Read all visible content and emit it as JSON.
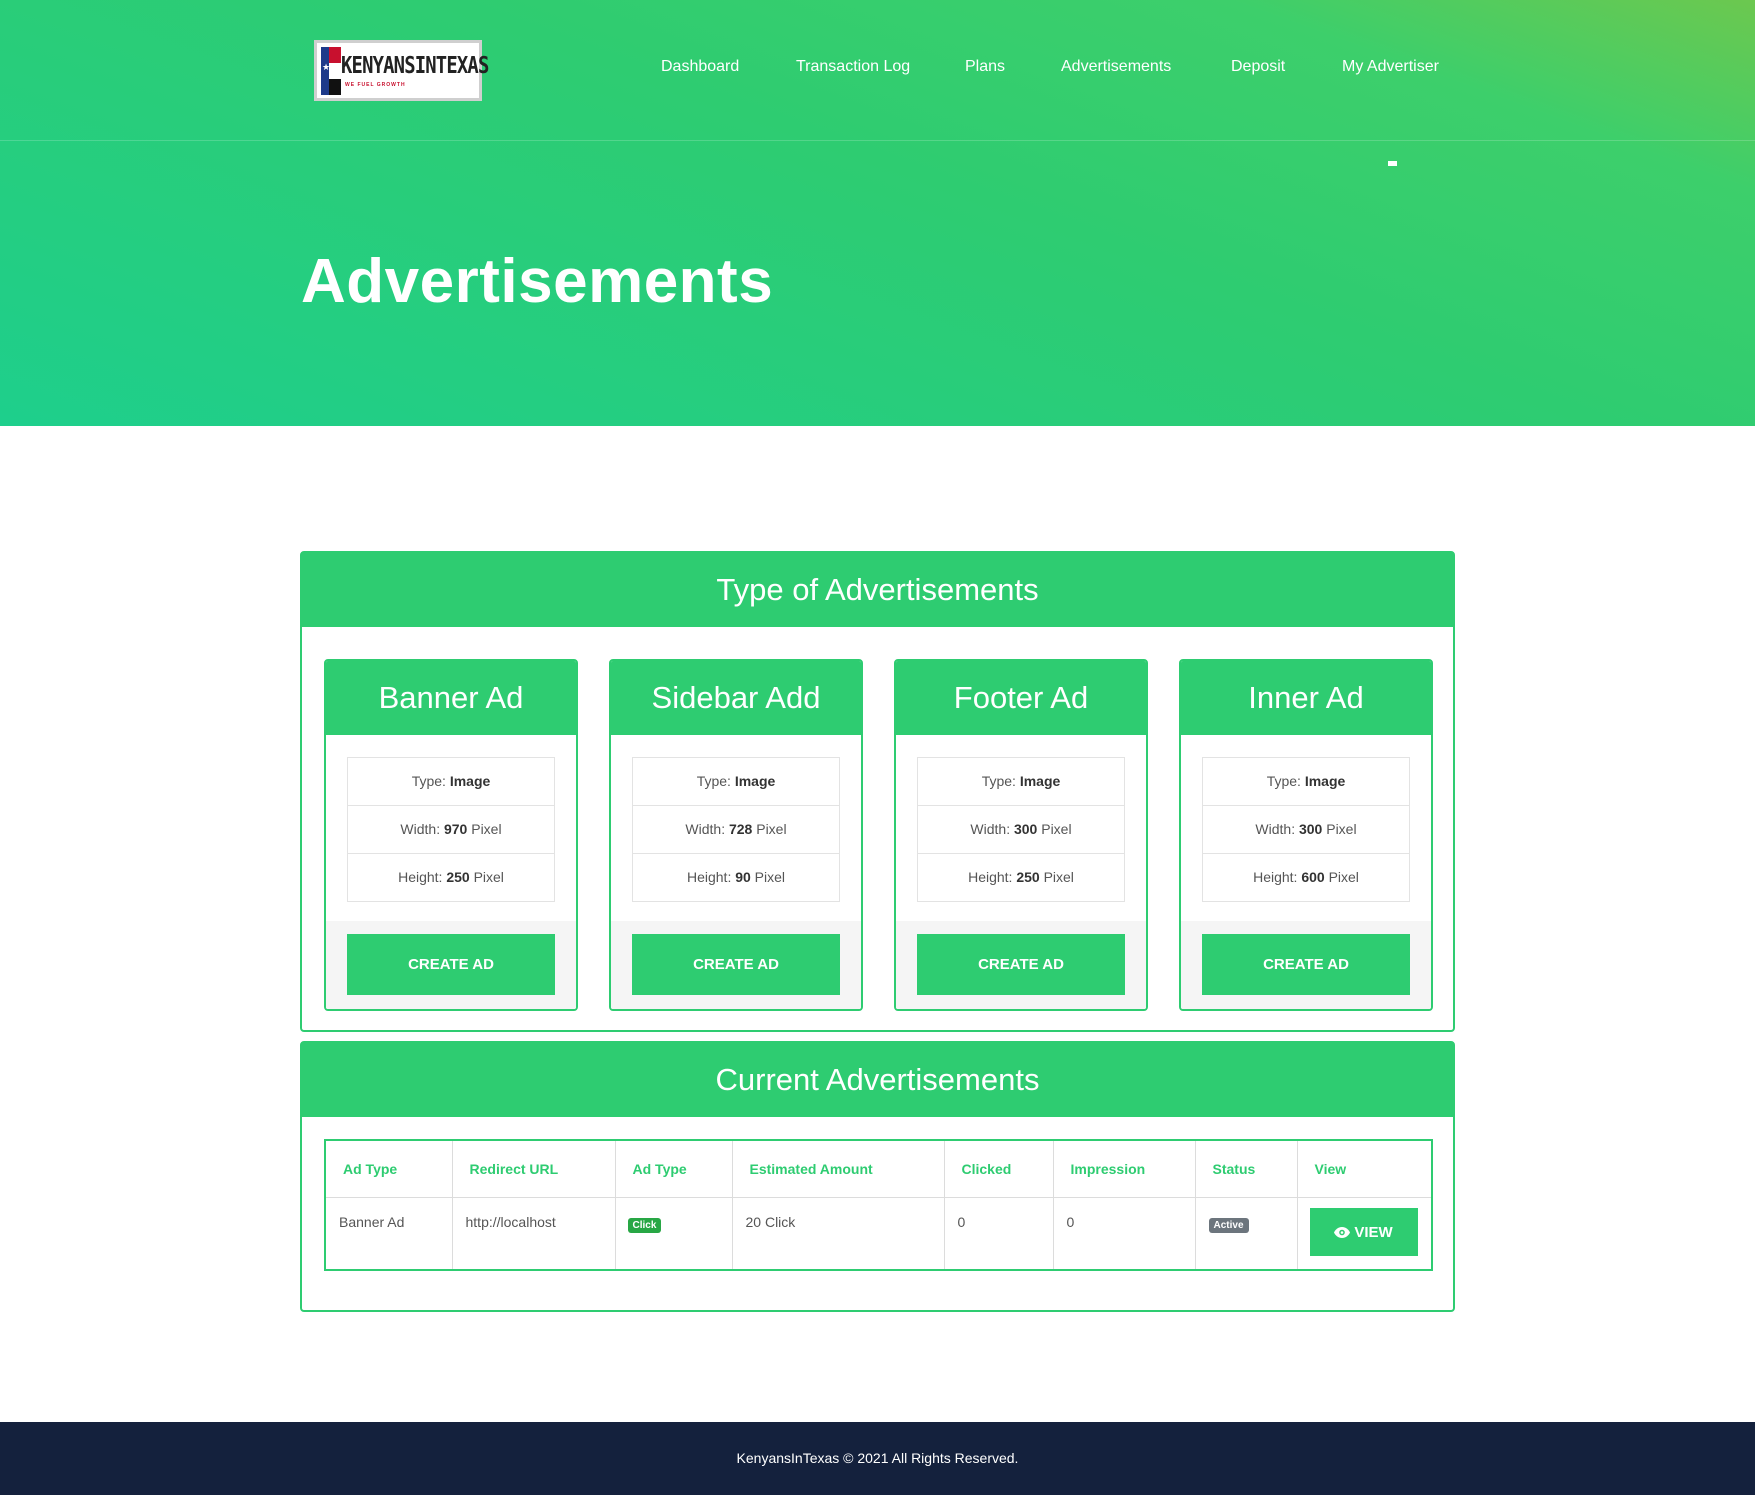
{
  "header": {
    "logo": {
      "wordmark": "KENYANSINTEXAS",
      "tagline": "WE FUEL GROWTH"
    },
    "nav": [
      {
        "label": "Dashboard"
      },
      {
        "label": "Transaction Log"
      },
      {
        "label": "Plans"
      },
      {
        "label": "Advertisements"
      },
      {
        "label": "Deposit"
      },
      {
        "label": "My Advertiser"
      }
    ],
    "page_title": "Advertisements"
  },
  "types_panel": {
    "title": "Type of Advertisements",
    "cards": [
      {
        "title": "Banner Ad",
        "type_label": "Type: ",
        "type": "Image",
        "width_label": "Width: ",
        "width": "970",
        "height_label": "Height: ",
        "height": "250",
        "unit": " Pixel",
        "button": "CREATE AD"
      },
      {
        "title": "Sidebar Add",
        "type_label": "Type: ",
        "type": "Image",
        "width_label": "Width: ",
        "width": "728",
        "height_label": "Height: ",
        "height": "90",
        "unit": " Pixel",
        "button": "CREATE AD"
      },
      {
        "title": "Footer Ad",
        "type_label": "Type: ",
        "type": "Image",
        "width_label": "Width: ",
        "width": "300",
        "height_label": "Height: ",
        "height": "250",
        "unit": " Pixel",
        "button": "CREATE AD"
      },
      {
        "title": "Inner Ad",
        "type_label": "Type: ",
        "type": "Image",
        "width_label": "Width: ",
        "width": "300",
        "height_label": "Height: ",
        "height": "600",
        "unit": " Pixel",
        "button": "CREATE AD"
      }
    ]
  },
  "current_panel": {
    "title": "Current Advertisements",
    "columns": [
      "Ad Type",
      "Redirect URL",
      "Ad Type",
      "Estimated Amount",
      "Clicked",
      "Impression",
      "Status",
      "View"
    ],
    "rows": [
      {
        "ad_type": "Banner Ad",
        "redirect_url": "http://localhost",
        "ad_type_badge": "Click",
        "estimated_amount": "20 Click",
        "clicked": "0",
        "impression": "0",
        "status": "Active",
        "view_label": "VIEW"
      }
    ]
  },
  "footer": {
    "text": "KenyansInTexas © 2021 All Rights Reserved."
  },
  "colors": {
    "brand_green": "#2ecc71",
    "footer_navy": "#14213d",
    "badge_click": "#28a745",
    "badge_active": "#6c757d"
  }
}
